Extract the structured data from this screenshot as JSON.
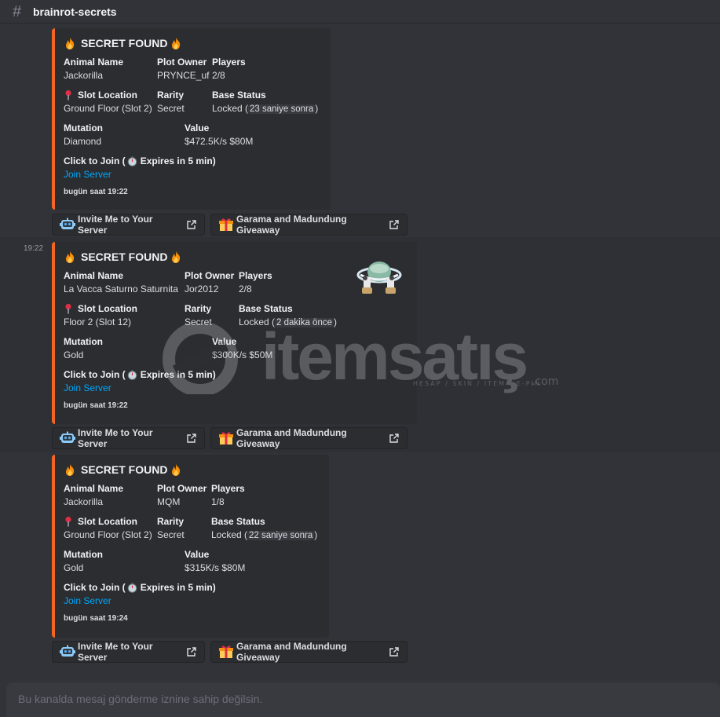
{
  "channel": {
    "name": "brainrot-secrets"
  },
  "messages": [
    {
      "timestamp": "",
      "title": "SECRET FOUND",
      "fields": {
        "animal_name_label": "Animal Name",
        "animal_name": "Jackorilla",
        "plot_owner_label": "Plot Owner",
        "plot_owner": "PRYNCE_uf",
        "players_label": "Players",
        "players": "2/8",
        "slot_location_label": "Slot Location",
        "slot_location": "Ground Floor (Slot 2)",
        "rarity_label": "Rarity",
        "rarity": "Secret",
        "base_status_label": "Base Status",
        "base_status": "Locked (",
        "base_status_time": "23 saniye sonra",
        "base_status_end": ")",
        "mutation_label": "Mutation",
        "mutation": "Diamond",
        "value_label": "Value",
        "value": "$472.5K/s $80M"
      },
      "join_label_a": "Click to Join (",
      "join_label_b": "Expires in 5 min)",
      "join_link": "Join Server",
      "footer": "bugün saat 19:22"
    },
    {
      "timestamp": "19:22",
      "title": "SECRET FOUND",
      "fields": {
        "animal_name_label": "Animal Name",
        "animal_name": "La Vacca Saturno Saturnita",
        "plot_owner_label": "Plot Owner",
        "plot_owner": "Jor2012",
        "players_label": "Players",
        "players": "2/8",
        "slot_location_label": "Slot Location",
        "slot_location": "Floor 2 (Slot 12)",
        "rarity_label": "Rarity",
        "rarity": "Secret",
        "base_status_label": "Base Status",
        "base_status": "Locked (",
        "base_status_time": "2 dakika önce",
        "base_status_end": ")",
        "mutation_label": "Mutation",
        "mutation": "Gold",
        "value_label": "Value",
        "value": "$300K/s $50M"
      },
      "join_label_a": "Click to Join (",
      "join_label_b": "Expires in 5 min)",
      "join_link": "Join Server",
      "footer": "bugün saat 19:22"
    },
    {
      "timestamp": "",
      "title": "SECRET FOUND",
      "fields": {
        "animal_name_label": "Animal Name",
        "animal_name": "Jackorilla",
        "plot_owner_label": "Plot Owner",
        "plot_owner": "MQM",
        "players_label": "Players",
        "players": "1/8",
        "slot_location_label": "Slot Location",
        "slot_location": "Ground Floor (Slot 2)",
        "rarity_label": "Rarity",
        "rarity": "Secret",
        "base_status_label": "Base Status",
        "base_status": "Locked (",
        "base_status_time": "22 saniye sonra",
        "base_status_end": ")",
        "mutation_label": "Mutation",
        "mutation": "Gold",
        "value_label": "Value",
        "value": "$315K/s $80M"
      },
      "join_label_a": "Click to Join (",
      "join_label_b": "Expires in 5 min)",
      "join_link": "Join Server",
      "footer": "bugün saat 19:24"
    }
  ],
  "buttons": {
    "invite": "Invite Me to Your Server",
    "giveaway": "Garama and Madundung Giveaway"
  },
  "watermark": {
    "word": "itemsatış",
    "tagline": "HESAP / SKIN / ITEM / E-PIN",
    "dotcom": ".com"
  },
  "composer": {
    "placeholder": "Bu kanalda mesaj gönderme iznine sahip değilsin."
  },
  "colors": {
    "accent": "#f26522",
    "link": "#00a8fc",
    "background": "#313338",
    "embed": "#2b2d31"
  }
}
